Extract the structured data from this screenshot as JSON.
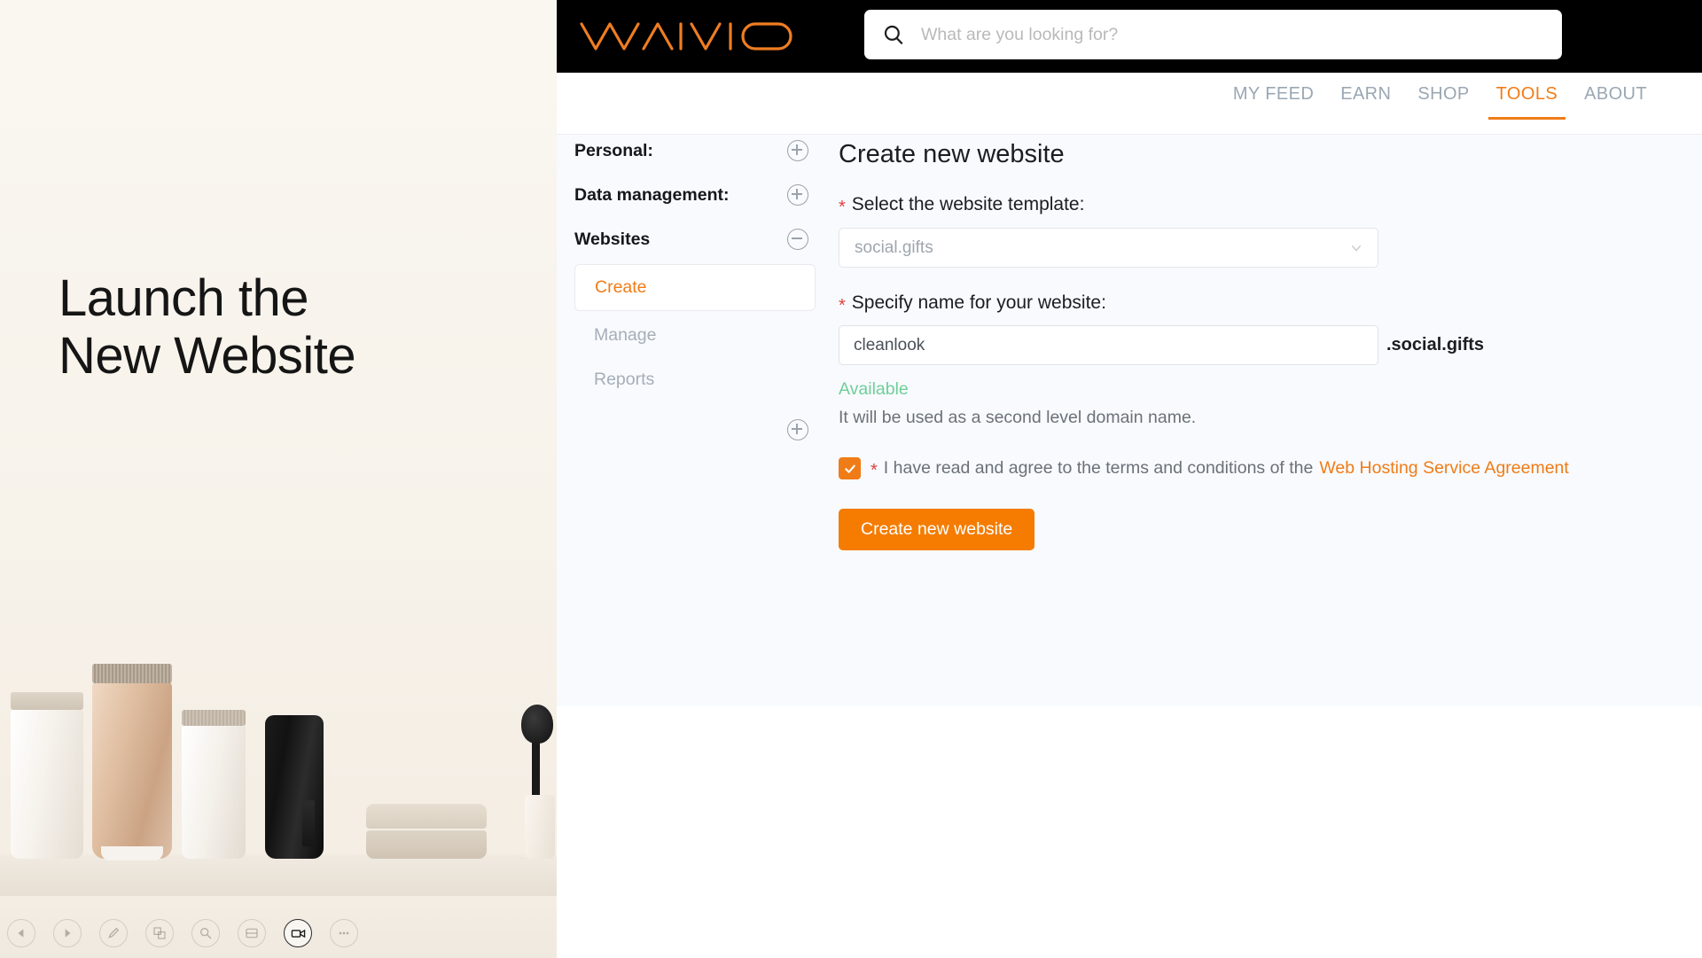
{
  "left_panel": {
    "hero_title": "Launch the\nNew Website",
    "toolbar": [
      {
        "name": "back-icon",
        "label": "Back"
      },
      {
        "name": "play-icon",
        "label": "Play"
      },
      {
        "name": "pen-icon",
        "label": "Annotate"
      },
      {
        "name": "layers-icon",
        "label": "Layers"
      },
      {
        "name": "magnifier-icon",
        "label": "Zoom"
      },
      {
        "name": "window-icon",
        "label": "Window"
      },
      {
        "name": "video-camera-icon",
        "label": "Record"
      },
      {
        "name": "more-icon",
        "label": "More"
      }
    ]
  },
  "header": {
    "brand": "WAIVIO",
    "search": {
      "placeholder": "What are you looking for?",
      "value": "",
      "icon": "search-icon"
    }
  },
  "nav": {
    "items": [
      {
        "label": "MY FEED",
        "active": false
      },
      {
        "label": "EARN",
        "active": false
      },
      {
        "label": "SHOP",
        "active": false
      },
      {
        "label": "TOOLS",
        "active": true
      },
      {
        "label": "ABOUT",
        "active": false
      }
    ]
  },
  "sidebar": {
    "groups": [
      {
        "label": "Personal:",
        "toggle": "plus-circle-icon"
      },
      {
        "label": "Data management:",
        "toggle": "plus-circle-icon"
      },
      {
        "label": "Websites",
        "toggle": "minus-circle-icon"
      }
    ],
    "website_items": [
      {
        "label": "Create",
        "active": true
      },
      {
        "label": "Manage",
        "active": false
      },
      {
        "label": "Reports",
        "active": false
      }
    ],
    "footer_toggle": "plus-circle-icon"
  },
  "form": {
    "title": "Create new website",
    "required_mark": "*",
    "template_label": "Select the website template:",
    "template_value": "social.gifts",
    "name_label": "Specify name for your website:",
    "name_value": "cleanlook",
    "name_placeholder": "",
    "domain_suffix": ".social.gifts",
    "availability": "Available",
    "hint": "It will be used as a second level domain name.",
    "terms_text": "I have read and agree to the terms and conditions of the",
    "terms_link": "Web Hosting Service Agreement",
    "submit_label": "Create new website"
  },
  "colors": {
    "accent": "#f07c17",
    "submit": "#f57c00",
    "available": "#6ecf9a",
    "required": "#e0403f",
    "nav_inactive": "#9aa7b3",
    "header_bg": "#000000",
    "content_bg": "#f8fafd"
  }
}
